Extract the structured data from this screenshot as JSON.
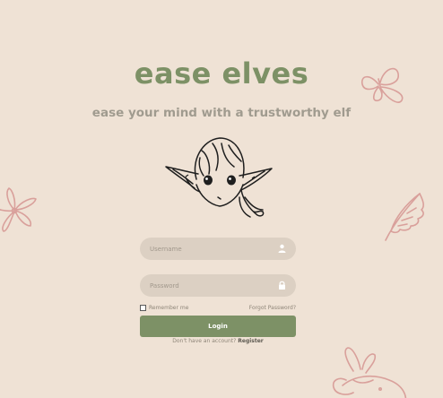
{
  "app": {
    "title": "ease elves",
    "tagline": "ease your mind with a trustworthy elf"
  },
  "login_form": {
    "username_placeholder": "Username",
    "password_placeholder": "Password",
    "remember_label": "Remember me",
    "forgot_label": "Forgot Password?",
    "login_label": "Login",
    "no_account_text": "Don't have an account?",
    "register_label": "Register",
    "username_icon": "user-icon",
    "password_icon": "lock-icon"
  },
  "illustrations": {
    "mascot": "elf-face-icon",
    "doodles": [
      "butterfly-icon",
      "flower-icon",
      "leaf-icon",
      "bunny-icon"
    ]
  },
  "colors": {
    "background": "#efe2d5",
    "accent_green": "#7d9166",
    "input_fill": "#dcd0c3",
    "doodle_pink": "#d9a09b",
    "muted_text": "#a09b8f"
  }
}
